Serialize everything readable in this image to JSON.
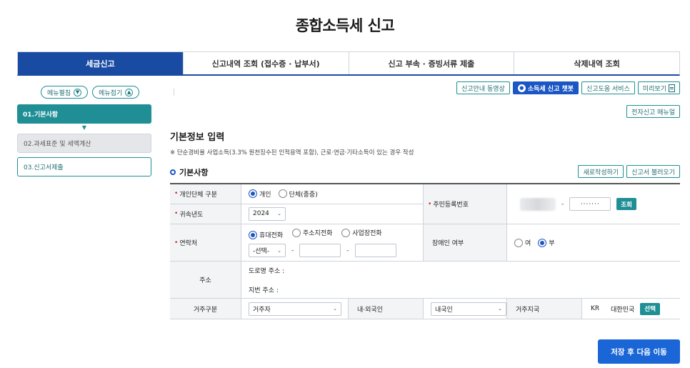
{
  "page_title": "종합소득세 신고",
  "tabs": [
    {
      "label": "세금신고",
      "active": true
    },
    {
      "label": "신고내역 조회 (접수증 · 납부서)",
      "active": false
    },
    {
      "label": "신고 부속 · 증빙서류 제출",
      "active": false
    },
    {
      "label": "삭제내역 조회",
      "active": false
    }
  ],
  "sidebar": {
    "expand_label": "메뉴펼침",
    "collapse_label": "메뉴접기",
    "steps": [
      {
        "label": "01.기본사항"
      },
      {
        "label": "02.과세표준 및 세액계산"
      },
      {
        "label": "03.신고서제출"
      }
    ]
  },
  "toolbar": {
    "guide_video": "신고안내 동영상",
    "chatbot": "소득세 신고 챗봇",
    "help_service": "신고도움 서비스",
    "preview": "미리보기",
    "manual": "전자신고 매뉴얼"
  },
  "section": {
    "title": "기본정보 입력",
    "note": "※ 단순경비율 사업소득(3.3% 원천징수된 인적용역 포함), 근로·연금·기타소득이 있는 경우 작성",
    "subtitle": "기본사항",
    "new_write": "새로작성하기",
    "load": "신고서 불러오기"
  },
  "form": {
    "entity_type": {
      "label": "개인단체 구분",
      "options": [
        "개인",
        "단체(종중)"
      ],
      "selected": "개인"
    },
    "year": {
      "label": "귀속년도",
      "value": "2024"
    },
    "resident_no": {
      "label": "주민등록번호",
      "masked": "·······",
      "lookup": "조회"
    },
    "contact": {
      "label": "연락처",
      "options": [
        "휴대전화",
        "주소지전화",
        "사업장전화"
      ],
      "selected": "휴대전화",
      "prefix_select": "-선택-"
    },
    "disability": {
      "label": "장애인 여부",
      "options": [
        "여",
        "부"
      ],
      "selected": "부"
    },
    "address": {
      "label": "주소",
      "road": "도로명 주소 :",
      "lot": "지번 주소 :"
    },
    "residence_type": {
      "label": "거주구분",
      "value": "거주자"
    },
    "nationality": {
      "label": "내·외국인",
      "value": "내국인"
    },
    "residence_country": {
      "label": "거주지국",
      "code": "KR",
      "name": "대한민국",
      "select": "선택"
    }
  },
  "save_next": "저장 후 다음 이동",
  "colors": {
    "primary": "#1a4ba3",
    "teal": "#1f8f95",
    "blue": "#1a66d6",
    "required": "#d22222"
  }
}
